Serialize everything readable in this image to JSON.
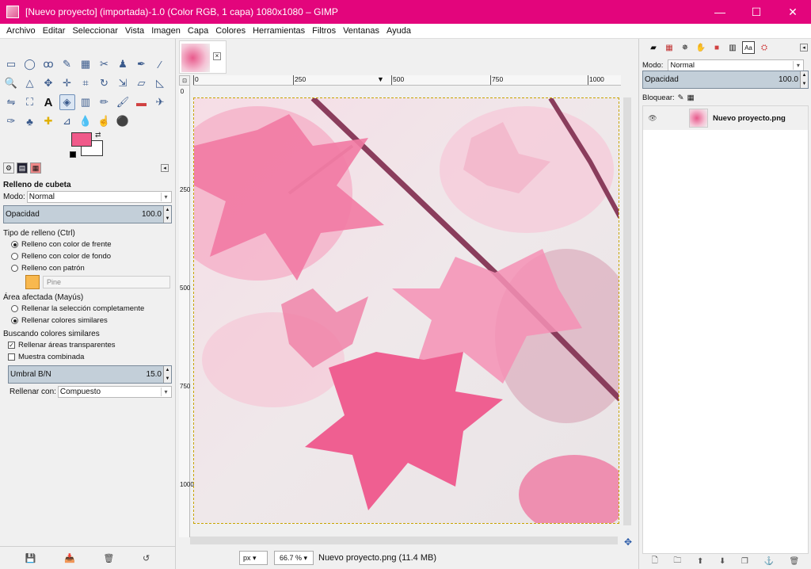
{
  "window": {
    "title": "[Nuevo proyecto] (importada)-1.0 (Color RGB, 1 capa) 1080x1080 – GIMP",
    "minimize": "—",
    "maximize": "☐",
    "close": "✕"
  },
  "menu": [
    "Archivo",
    "Editar",
    "Seleccionar",
    "Vista",
    "Imagen",
    "Capa",
    "Colores",
    "Herramientas",
    "Filtros",
    "Ventanas",
    "Ayuda"
  ],
  "colors": {
    "accent": "#e3057c",
    "foreground": "#f05a8a",
    "background": "#ffffff"
  },
  "tool_options": {
    "title": "Relleno de cubeta",
    "mode_label": "Modo:",
    "mode_value": "Normal",
    "opacity_label": "Opacidad",
    "opacity_value": "100.0",
    "fill_type_label": "Tipo de relleno  (Ctrl)",
    "fill_fg": "Relleno con color de frente",
    "fill_bg": "Relleno con color de fondo",
    "fill_pattern": "Relleno con patrón",
    "pattern_name": "Pine",
    "affected_label": "Área afectada  (Mayús)",
    "affected_whole": "Rellenar la selección completamente",
    "affected_similar": "Rellenar colores similares",
    "finding_label": "Buscando colores similares",
    "fill_transparent": "Rellenar áreas transparentes",
    "sample_merged": "Muestra combinada",
    "threshold_label": "Umbral B/N",
    "threshold_value": "15.0",
    "fill_by_label": "Rellenar con:",
    "fill_by_value": "Compuesto"
  },
  "ruler": {
    "h": [
      "0",
      "250",
      "500",
      "750",
      "1000"
    ],
    "v": [
      "0",
      "250",
      "500",
      "750",
      "1000"
    ]
  },
  "status": {
    "unit": "px",
    "zoom": "66.7 %",
    "text": "Nuevo proyecto.png (11.4 MB)"
  },
  "layers": {
    "mode_label": "Modo:",
    "mode_value": "Normal",
    "opacity_label": "Opacidad",
    "opacity_value": "100.0",
    "lock_label": "Bloquear:",
    "layer_name": "Nuevo proyecto.png"
  }
}
